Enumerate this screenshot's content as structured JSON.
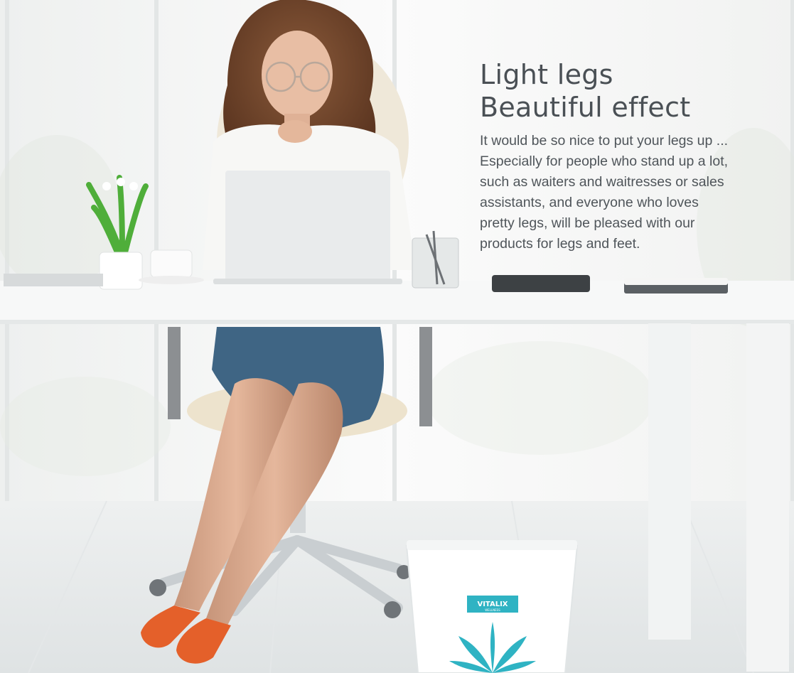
{
  "headline": {
    "line1": "Light legs",
    "line2": "Beautiful effect"
  },
  "body_text": "It would be so nice to put your legs up ... Especially for people who stand up a lot, such as waiters and waitresses or sales assistants, and everyone who loves pretty legs, will be pleased with our products for legs and feet.",
  "product": {
    "brand": "VITALIX",
    "sub_brand": "WELLNESS"
  },
  "colors": {
    "text": "#4a5055",
    "accent_teal": "#2fb3c3",
    "shoes": "#e4602a",
    "skirt": "#3f6584"
  }
}
